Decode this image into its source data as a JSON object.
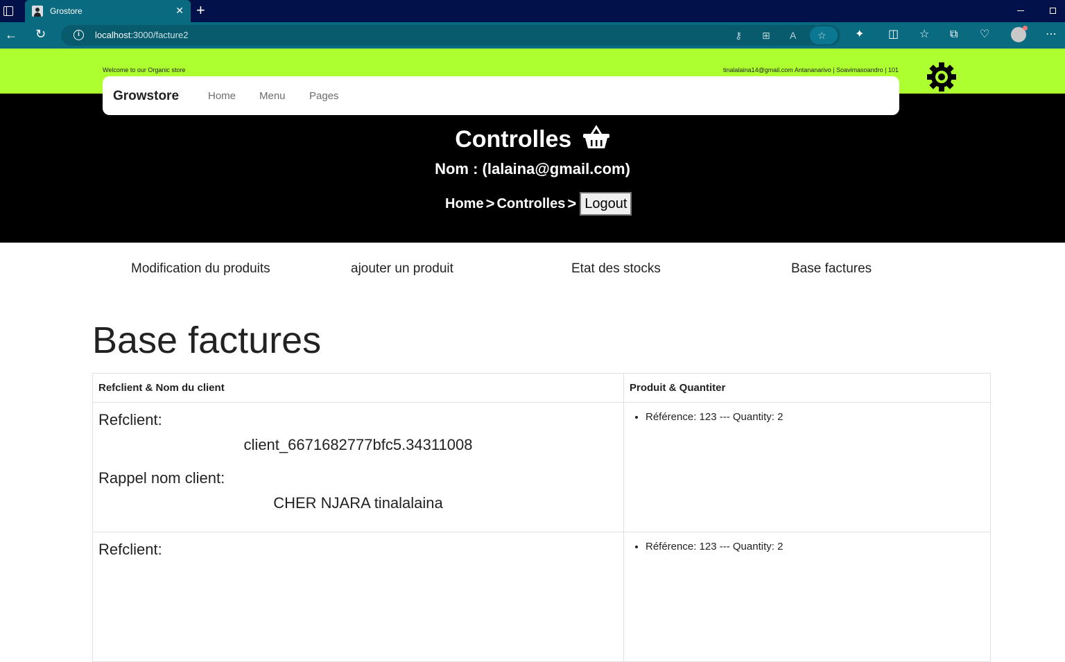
{
  "browser": {
    "tab_title": "Grostore",
    "url_host": "localhost",
    "url_path": ":3000/facture2"
  },
  "topbar": {
    "welcome": "Welcome to our Organic store",
    "contact": "tinalalaina14@gmail.com  Antananarivo | Soavimasoandro | 101"
  },
  "navbar": {
    "brand": "Growstore",
    "links": [
      "Home",
      "Menu",
      "Pages"
    ]
  },
  "hero": {
    "title": "Controlles",
    "name_line": "Nom : (lalaina@gmail.com)",
    "breadcrumb": [
      "Home",
      "Controlles"
    ],
    "separator": ">",
    "logout_label": "Logout"
  },
  "menu": [
    "Modification du produits",
    "ajouter un produit",
    "Etat des stocks",
    "Base factures"
  ],
  "page_heading": "Base factures",
  "table": {
    "headers": [
      "Refclient & Nom du client",
      "Produit & Quantiter"
    ],
    "rows": [
      {
        "ref_label": "Refclient:",
        "ref_value": "client_6671682777bfc5.34311008",
        "name_label": "Rappel nom client:",
        "name_value": "CHER NJARA tinalalaina",
        "products": [
          "Référence: 123 --- Quantity: 2"
        ]
      },
      {
        "ref_label": "Refclient:",
        "products": [
          "Référence: 123 --- Quantity: 2"
        ]
      }
    ]
  },
  "colors": {
    "topbar_bg": "#adff2f",
    "hero_bg": "#000000",
    "browser_tab": "#0a6a80",
    "browser_frame": "#03114a"
  }
}
